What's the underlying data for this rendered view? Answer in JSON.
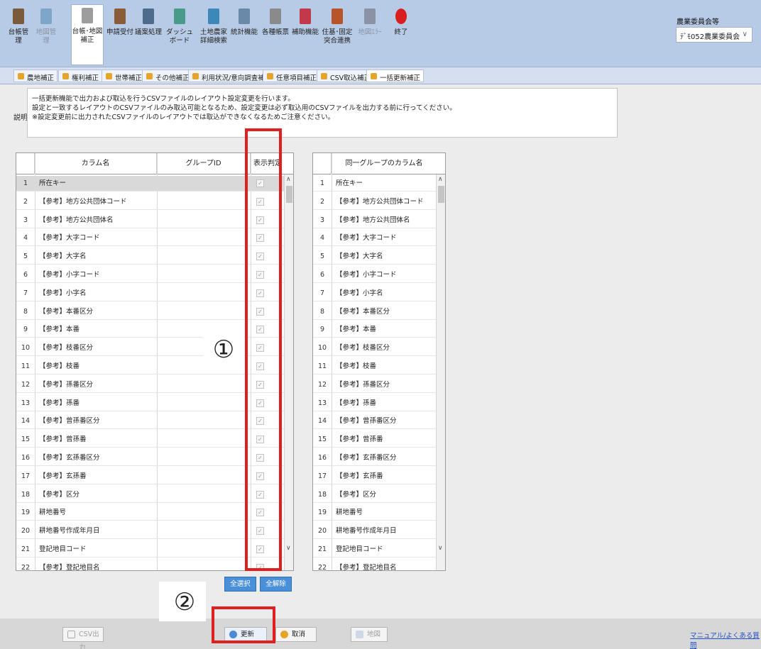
{
  "toolbar": {
    "tools": [
      {
        "label": "台帳管理",
        "icon": "building-icon",
        "color": "#7a5a3a",
        "disabled": false
      },
      {
        "label": "地図管理",
        "icon": "map-icon",
        "color": "#7fa6c9",
        "disabled": true
      },
      {
        "label": "台帳･地図\n補正",
        "icon": "ledger-edit-icon",
        "color": "#9d9d9d",
        "disabled": false,
        "active": true
      },
      {
        "label": "申請受付",
        "icon": "stamp-icon",
        "color": "#8a5c3a",
        "disabled": false
      },
      {
        "label": "議案処理",
        "icon": "gavel-icon",
        "color": "#4d6b8a",
        "disabled": false
      },
      {
        "label": "ダッシュ\nボード",
        "icon": "dashboard-icon",
        "color": "#4a9a8a",
        "disabled": false
      },
      {
        "label": "土地農家\n詳細検索",
        "icon": "search-doc-icon",
        "color": "#3c88b8",
        "disabled": false
      },
      {
        "label": "統計機能",
        "icon": "stats-icon",
        "color": "#6a88a8",
        "disabled": false
      },
      {
        "label": "各種帳票",
        "icon": "print-icon",
        "color": "#8a8a8a",
        "disabled": false
      },
      {
        "label": "補助機能",
        "icon": "tools-icon",
        "color": "#c23a4a",
        "disabled": false
      },
      {
        "label": "住基･固定\n突合連携",
        "icon": "link-doc-icon",
        "color": "#b8542a",
        "disabled": false
      },
      {
        "label": "地図ｴﾗｰ",
        "icon": "chain-icon",
        "color": "#8a93a6",
        "disabled": true
      },
      {
        "label": "終了",
        "icon": "exit-icon",
        "color": "#d81e1e",
        "disabled": false
      }
    ],
    "group_label": "農業委員会等",
    "group_value": "ﾃﾞﾓ052農業委員会"
  },
  "subtabs": [
    {
      "label": "農地補正",
      "active": false
    },
    {
      "label": "権利補正",
      "active": false
    },
    {
      "label": "世帯補正",
      "active": false
    },
    {
      "label": "その他補正",
      "active": false
    },
    {
      "label": "利用状況/意向調査補正",
      "active": false
    },
    {
      "label": "任意項目補正",
      "active": false
    },
    {
      "label": "CSV取込補正",
      "active": false
    },
    {
      "label": "一括更新補正",
      "active": true
    }
  ],
  "description": {
    "label": "説明",
    "lines": [
      "一括更新機能で出力および取込を行うCSVファイルのレイアウト設定変更を行います。",
      "設定と一致するレイアウトのCSVファイルのみ取込可能となるため、設定変更は必ず取込用のCSVファイルを出力する前に行ってください。",
      "※設定変更前に出力されたCSVファイルのレイアウトでは取込ができなくなるためご注意ください。"
    ]
  },
  "left_table": {
    "headers": {
      "column_name": "カラム名",
      "group_id": "グループID",
      "display": "表示判定"
    },
    "rows": [
      {
        "no": "1",
        "name": "所在キー"
      },
      {
        "no": "2",
        "name": "【参考】地方公共団体コード"
      },
      {
        "no": "3",
        "name": "【参考】地方公共団体名"
      },
      {
        "no": "4",
        "name": "【参考】大字コード"
      },
      {
        "no": "5",
        "name": "【参考】大字名"
      },
      {
        "no": "6",
        "name": "【参考】小字コード"
      },
      {
        "no": "7",
        "name": "【参考】小字名"
      },
      {
        "no": "8",
        "name": "【参考】本番区分"
      },
      {
        "no": "9",
        "name": "【参考】本番"
      },
      {
        "no": "10",
        "name": "【参考】枝番区分"
      },
      {
        "no": "11",
        "name": "【参考】枝番"
      },
      {
        "no": "12",
        "name": "【参考】孫番区分"
      },
      {
        "no": "13",
        "name": "【参考】孫番"
      },
      {
        "no": "14",
        "name": "【参考】曾孫番区分"
      },
      {
        "no": "15",
        "name": "【参考】曾孫番"
      },
      {
        "no": "16",
        "name": "【参考】玄孫番区分"
      },
      {
        "no": "17",
        "name": "【参考】玄孫番"
      },
      {
        "no": "18",
        "name": "【参考】区分"
      },
      {
        "no": "19",
        "name": "耕地番号"
      },
      {
        "no": "20",
        "name": "耕地番号作成年月日"
      },
      {
        "no": "21",
        "name": "登記地目コード"
      },
      {
        "no": "22",
        "name": "【参考】登記地目名"
      }
    ]
  },
  "right_table": {
    "header": "同一グループのカラム名",
    "rows": [
      {
        "no": "1",
        "name": "所在キー"
      },
      {
        "no": "2",
        "name": "【参考】地方公共団体コード"
      },
      {
        "no": "3",
        "name": "【参考】地方公共団体名"
      },
      {
        "no": "4",
        "name": "【参考】大字コード"
      },
      {
        "no": "5",
        "name": "【参考】大字名"
      },
      {
        "no": "6",
        "name": "【参考】小字コード"
      },
      {
        "no": "7",
        "name": "【参考】小字名"
      },
      {
        "no": "8",
        "name": "【参考】本番区分"
      },
      {
        "no": "9",
        "name": "【参考】本番"
      },
      {
        "no": "10",
        "name": "【参考】枝番区分"
      },
      {
        "no": "11",
        "name": "【参考】枝番"
      },
      {
        "no": "12",
        "name": "【参考】孫番区分"
      },
      {
        "no": "13",
        "name": "【参考】孫番"
      },
      {
        "no": "14",
        "name": "【参考】曾孫番区分"
      },
      {
        "no": "15",
        "name": "【参考】曾孫番"
      },
      {
        "no": "16",
        "name": "【参考】玄孫番区分"
      },
      {
        "no": "17",
        "name": "【参考】玄孫番"
      },
      {
        "no": "18",
        "name": "【参考】区分"
      },
      {
        "no": "19",
        "name": "耕地番号"
      },
      {
        "no": "20",
        "name": "耕地番号作成年月日"
      },
      {
        "no": "21",
        "name": "登記地目コード"
      },
      {
        "no": "22",
        "name": "【参考】登記地目名"
      }
    ]
  },
  "actions": {
    "select_all": "全選択",
    "clear_all": "全解除"
  },
  "footer": {
    "csv_output": "CSV出力",
    "update": "更新",
    "cancel": "取消",
    "map": "地図",
    "manual": "マニュアル/よくある質問"
  },
  "annotations": {
    "one": "①",
    "two": "②"
  },
  "colors": {
    "accent_red": "#e02020",
    "header_bg": "#b8cbe6",
    "button_blue": "#4a90d9"
  }
}
